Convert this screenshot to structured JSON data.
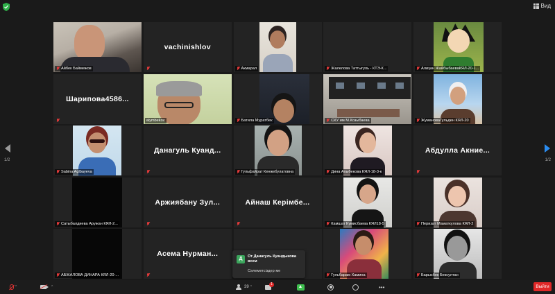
{
  "topbar": {
    "view_label": "Вид"
  },
  "participants": [
    {
      "name": "Айбек Баймежов",
      "muted": true,
      "video": "photo"
    },
    {
      "name": "vachinishlov",
      "muted": true,
      "video": "none",
      "big": "vachinishlov",
      "hide_label": true
    },
    {
      "name": "Акмарал",
      "muted": true,
      "video": "woman1"
    },
    {
      "name": "Жалелова Таттыгуль - КТЭ-К...",
      "muted": true,
      "video": "none"
    },
    {
      "name": "Алиҳан ЖайбыбаеваКЯЛ-20-1...",
      "muted": true,
      "video": "anime"
    },
    {
      "name": "Шарипова4586...",
      "muted": true,
      "video": "none",
      "big": "Шарипова4586...",
      "hide_label": true
    },
    {
      "name": "aiymbekov",
      "muted": false,
      "video": "man2",
      "active": true
    },
    {
      "name": "Батила Муратбек",
      "muted": true,
      "video": "woman2"
    },
    {
      "name": "СКУ им М.Козыбаева",
      "muted": true,
      "video": "class"
    },
    {
      "name": "ЖумановаГульден КЯЛ-20",
      "muted": true,
      "video": "girl1"
    },
    {
      "name": "Sabina Aglbayeva",
      "muted": true,
      "video": "sabina"
    },
    {
      "name": "Данагуль Куанд...",
      "muted": true,
      "video": "none",
      "big": "Данагуль Куанд...",
      "hide_label": true
    },
    {
      "name": "Гульфайрат Кенжебулатовна",
      "muted": true,
      "video": "gulf"
    },
    {
      "name": "Дина Ахыбекова КЯЛ-18-3-к",
      "muted": true,
      "video": "dina"
    },
    {
      "name": "Абдулла Акние...",
      "muted": true,
      "video": "none",
      "big": "Абдулла Акние...",
      "hide_label": true
    },
    {
      "name": "Сатыбалдиева Аружан КЯЛ-2...",
      "muted": true,
      "video": "black"
    },
    {
      "name": "Аржиябану Зул...",
      "muted": true,
      "video": "none",
      "big": "Аржиябану Зул...",
      "hide_label": true
    },
    {
      "name": "Айнаш Керімбе...",
      "muted": true,
      "video": "none",
      "big": "Айнаш Керімбе...",
      "hide_label": true
    },
    {
      "name": "Камшат Кумисбаева КЯЛ18-5",
      "muted": true,
      "video": "kam"
    },
    {
      "name": "Перизат Маматкулова КЯЛ-2",
      "muted": true,
      "video": "perz"
    },
    {
      "name": "АБЖАЛОВА ДИНАРА КЯЛ-20-...",
      "muted": true,
      "video": "black"
    },
    {
      "name": "Асема Нурман...",
      "muted": true,
      "video": "none",
      "big": "Асема Нурман...",
      "hide_label": true
    },
    {
      "name": "",
      "muted": false,
      "video": "none",
      "hide_label": true
    },
    {
      "name": "Гульбарам Хамина",
      "muted": true,
      "video": "gulb"
    },
    {
      "name": "Барысбек Бексултан",
      "muted": true,
      "video": "bary"
    }
  ],
  "pagination": {
    "left": "1/2",
    "right": "1/2"
  },
  "chat_popup": {
    "avatar_letter": "Д",
    "from": "От Данагуль Куандыкова всем",
    "message": "Сәлеметсіздер ме"
  },
  "toolbar": {
    "participants_count": "39",
    "chat_badge": "1",
    "end_label": "Выйти"
  }
}
